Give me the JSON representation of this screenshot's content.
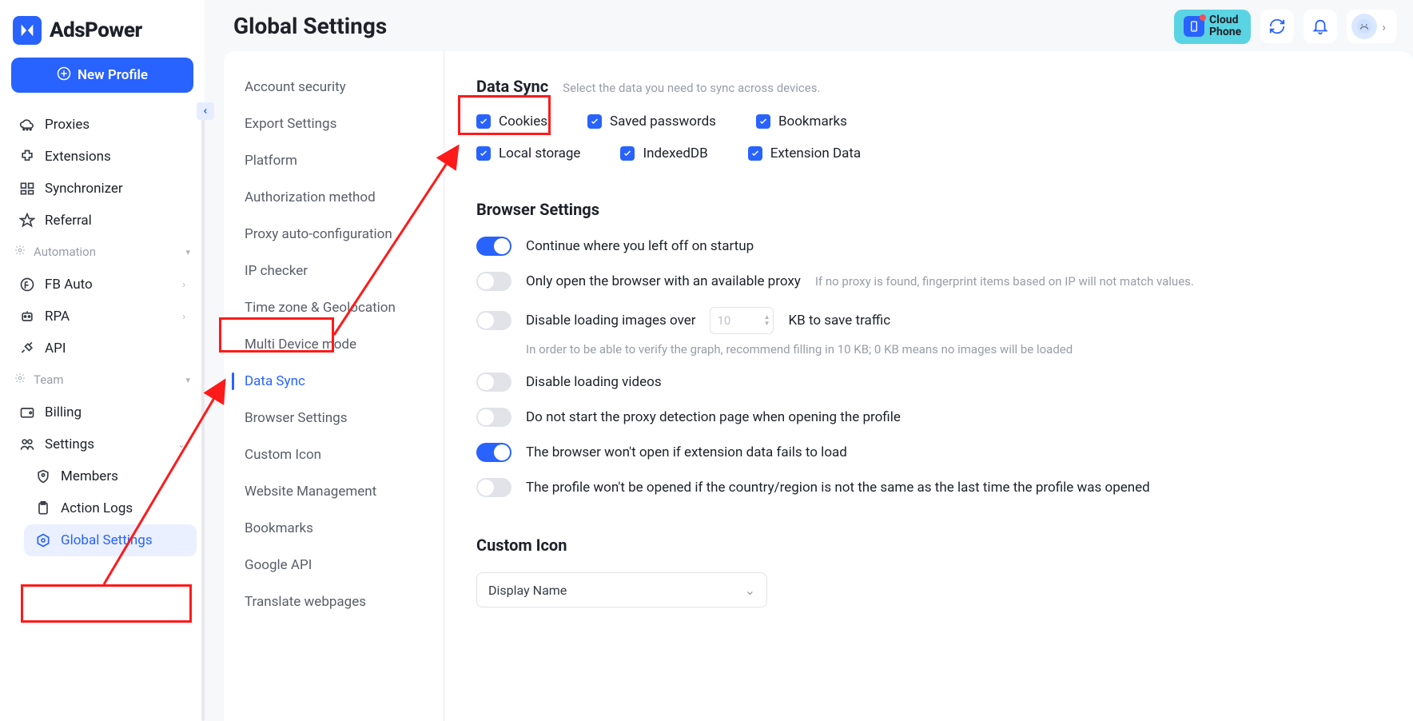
{
  "brand": {
    "name": "AdsPower"
  },
  "header": {
    "title": "Global Settings",
    "cloud_phone": "Cloud\nPhone"
  },
  "new_profile_label": "New Profile",
  "sidebar": {
    "items": [
      {
        "label": "Proxies"
      },
      {
        "label": "Extensions"
      },
      {
        "label": "Synchronizer"
      },
      {
        "label": "Referral"
      }
    ],
    "automation_label": "Automation",
    "automation_items": [
      {
        "label": "FB Auto"
      },
      {
        "label": "RPA"
      },
      {
        "label": "API"
      }
    ],
    "team_label": "Team",
    "team_items": [
      {
        "label": "Billing"
      },
      {
        "label": "Settings"
      }
    ],
    "settings_sub": [
      {
        "label": "Members"
      },
      {
        "label": "Action Logs"
      },
      {
        "label": "Global Settings",
        "active": true
      }
    ]
  },
  "subnav": [
    "Account security",
    "Export Settings",
    "Platform",
    "Authorization method",
    "Proxy auto-configuration",
    "IP checker",
    "Time zone & Geolocation",
    "Multi Device mode",
    "Data Sync",
    "Browser Settings",
    "Custom Icon",
    "Website Management",
    "Bookmarks",
    "Google API",
    "Translate webpages"
  ],
  "subnav_active_index": 8,
  "data_sync": {
    "title": "Data Sync",
    "hint": "Select the data you need to sync across devices.",
    "options": [
      "Cookies",
      "Saved passwords",
      "Bookmarks",
      "Local storage",
      "IndexedDB",
      "Extension Data"
    ]
  },
  "browser_settings": {
    "title": "Browser Settings",
    "rows": [
      {
        "on": true,
        "label": "Continue where you left off on startup"
      },
      {
        "on": false,
        "label": "Only open the browser with an available proxy",
        "note": "If no proxy is found, fingerprint items based on IP will not match values."
      },
      {
        "on": false,
        "label_pre": "Disable loading images over",
        "input_placeholder": "10",
        "label_post": "KB to save traffic",
        "subnote": "In order to be able to verify the graph, recommend filling in 10 KB; 0 KB means no images will be loaded"
      },
      {
        "on": false,
        "label": "Disable loading videos"
      },
      {
        "on": false,
        "label": "Do not start the proxy detection page when opening the profile"
      },
      {
        "on": true,
        "label": "The browser won't open if extension data fails to load"
      },
      {
        "on": false,
        "label": "The profile won't be opened if the country/region is not the same as the last time the profile was opened"
      }
    ]
  },
  "custom_icon": {
    "title": "Custom Icon",
    "select_value": "Display Name"
  }
}
